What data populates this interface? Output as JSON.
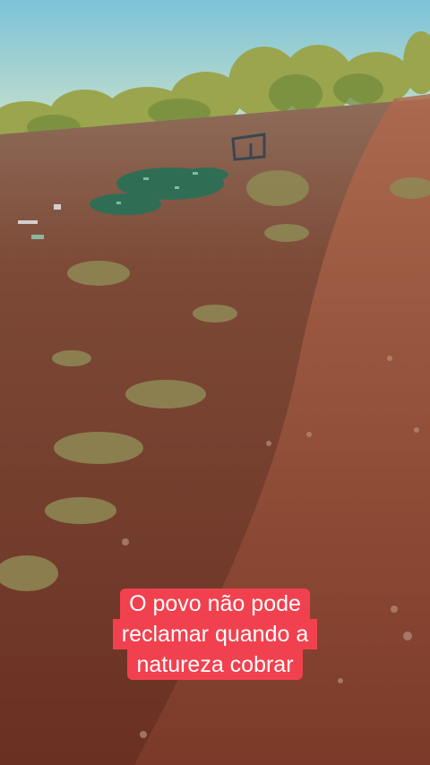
{
  "caption": {
    "lines": [
      "O povo não pode",
      "reclamar quando a",
      "natureza cobrar"
    ],
    "background_color": "#f1414f",
    "text_color": "#ffffff"
  },
  "scene": {
    "sky_color": "#8ec9dc",
    "soil_color": "#7a3a29",
    "vegetation_color": "#8a9a48",
    "debris_color": "#2f6e55"
  }
}
